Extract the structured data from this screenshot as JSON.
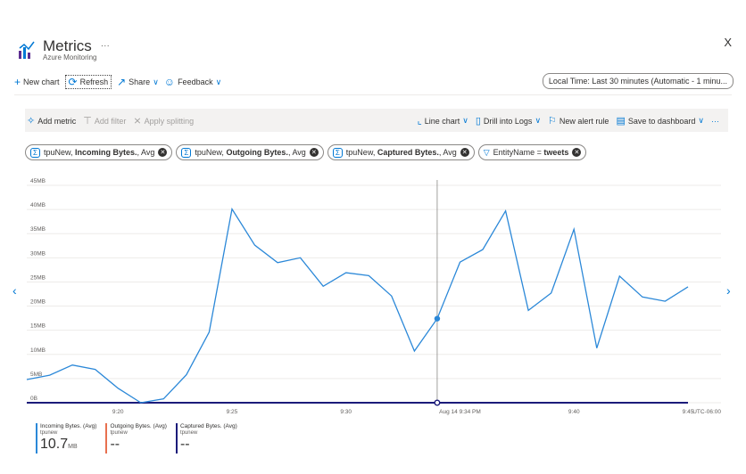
{
  "header": {
    "title": "Metrics",
    "more": "···",
    "subtitle": "Azure Monitoring",
    "close": "X"
  },
  "commandbar": {
    "new_chart": "New chart",
    "refresh": "Refresh",
    "share": "Share",
    "feedback": "Feedback",
    "time_range": "Local Time: Last 30 minutes (Automatic - 1 minu..."
  },
  "toolbar": {
    "add_metric": "Add metric",
    "add_filter": "Add filter",
    "apply_splitting": "Apply splitting",
    "line_chart": "Line chart",
    "drill_logs": "Drill into Logs",
    "new_alert": "New alert rule",
    "save_dashboard": "Save to dashboard",
    "more": "···"
  },
  "pills": [
    {
      "prefix": "tpuNew, ",
      "metric": "Incoming Bytes.",
      "suffix": ", Avg"
    },
    {
      "prefix": "tpuNew, ",
      "metric": "Outgoing Bytes.",
      "suffix": ", Avg"
    },
    {
      "prefix": "tpuNew, ",
      "metric": "Captured Bytes.",
      "suffix": ", Avg"
    }
  ],
  "filter_pill": {
    "key": "EntityName = ",
    "value": "tweets"
  },
  "colors": {
    "incoming": "#2b88d8",
    "outgoing": "#e8704f",
    "captured": "#1b1b7a",
    "accent": "#0078d4"
  },
  "chart_data": {
    "type": "line",
    "ylabels": [
      "45MB",
      "40MB",
      "35MB",
      "30MB",
      "25MB",
      "20MB",
      "15MB",
      "10MB",
      "5MB",
      "0B"
    ],
    "ylim": [
      0,
      45
    ],
    "xlabels": [
      {
        "t": 4,
        "label": "9:20"
      },
      {
        "t": 9,
        "label": "9:25"
      },
      {
        "t": 14,
        "label": "9:30"
      },
      {
        "t": 19,
        "label": "Aug 14 9:34 PM"
      },
      {
        "t": 24,
        "label": "9:40"
      },
      {
        "t": 29,
        "label": "9:45"
      }
    ],
    "timezone": "UTC-06:00",
    "cursor_t": 18,
    "series": [
      {
        "name": "Incoming Bytes. (Avg)",
        "values": [
          4.8,
          5.7,
          7.8,
          6.9,
          3.0,
          0.0,
          0.8,
          5.8,
          14.6,
          40.1,
          32.6,
          29.0,
          30.0,
          24.1,
          26.9,
          26.3,
          22.1,
          10.7,
          17.4,
          29.1,
          31.7,
          39.7,
          19.1,
          22.7,
          35.9,
          11.3,
          26.2,
          21.9,
          21.0,
          24.0
        ]
      },
      {
        "name": "Outgoing Bytes. (Avg)",
        "values": [
          0,
          0,
          0,
          0,
          0,
          0,
          0,
          0,
          0,
          0,
          0,
          0,
          0,
          0,
          0,
          0,
          0,
          0,
          0,
          0,
          0,
          0,
          0,
          0,
          0,
          0,
          0,
          0,
          0,
          0
        ]
      },
      {
        "name": "Captured Bytes. (Avg)",
        "values": [
          0,
          0,
          0,
          0,
          0,
          0,
          0,
          0,
          0,
          0,
          0,
          0,
          0,
          0,
          0,
          0,
          0,
          0,
          0,
          0,
          0,
          0,
          0,
          0,
          0,
          0,
          0,
          0,
          0,
          0
        ]
      }
    ]
  },
  "legend": [
    {
      "label": "Incoming Bytes. (Avg)",
      "resource": "tpunew",
      "value": "10.7",
      "unit": "MB"
    },
    {
      "label": "Outgoing Bytes. (Avg)",
      "resource": "tpunew",
      "value": "--",
      "unit": ""
    },
    {
      "label": "Captured Bytes. (Avg)",
      "resource": "tpunew",
      "value": "--",
      "unit": ""
    }
  ]
}
